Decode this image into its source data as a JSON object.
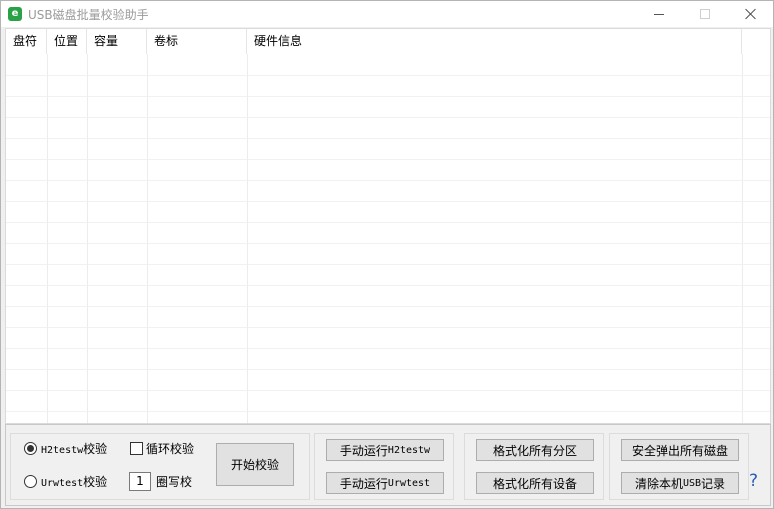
{
  "window": {
    "title": "USB磁盘批量校验助手",
    "app_icon_glyph": "e"
  },
  "listview": {
    "columns": [
      "盘符",
      "位置",
      "容量",
      "卷标",
      "硬件信息"
    ]
  },
  "options": {
    "radio_h2testw": {
      "label": "H2testw校验",
      "checked": true
    },
    "radio_urwtest": {
      "label": "Urwtest校验",
      "checked": false
    },
    "loop_check": {
      "label": "循环校验",
      "checked": false
    },
    "write_laps": {
      "value": "1",
      "label": "圈写校"
    },
    "start_button": "开始校验"
  },
  "manual": {
    "run_h2testw": "手动运行H2testw",
    "run_urwtest": "手动运行Urwtest"
  },
  "format": {
    "all_partitions": "格式化所有分区",
    "all_devices": "格式化所有设备"
  },
  "system": {
    "eject_all": "安全弹出所有磁盘",
    "clear_usb_records": "清除本机USB记录"
  },
  "help_label": "?",
  "colors": {
    "accent_icon": "#2aa147",
    "help": "#2b5bb7"
  }
}
